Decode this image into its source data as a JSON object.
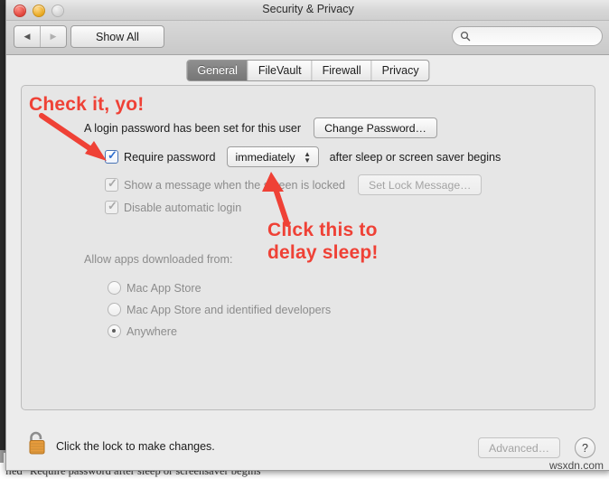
{
  "window": {
    "title": "Security & Privacy",
    "traffic_lights": [
      "close-button",
      "minimize-button",
      "zoom-button"
    ]
  },
  "toolbar": {
    "back_label": "◀",
    "forward_label": "▶",
    "show_all_label": "Show All",
    "search_placeholder": "",
    "search_value": "",
    "search_icon": "search-icon"
  },
  "tabs": [
    {
      "label": "General",
      "active": true
    },
    {
      "label": "FileVault",
      "active": false
    },
    {
      "label": "Firewall",
      "active": false
    },
    {
      "label": "Privacy",
      "active": false
    }
  ],
  "general": {
    "password_status": "A login password has been set for this user",
    "change_password_label": "Change Password…",
    "require_password": {
      "label": "Require password",
      "checked": true,
      "delay_value": "immediately",
      "suffix": "after sleep or screen saver begins"
    },
    "show_message": {
      "label": "Show a message when the screen is locked",
      "checked": true,
      "enabled": false,
      "button_label": "Set Lock Message…"
    },
    "disable_auto_login": {
      "label": "Disable automatic login",
      "checked": true,
      "enabled": false
    },
    "allow_apps_label": "Allow apps downloaded from:",
    "allow_apps_options": [
      {
        "label": "Mac App Store",
        "selected": false
      },
      {
        "label": "Mac App Store and identified developers",
        "selected": false
      },
      {
        "label": "Anywhere",
        "selected": true
      }
    ]
  },
  "footer": {
    "lock_icon": "open-padlock-icon",
    "lock_message": "Click the lock to make changes.",
    "advanced_label": "Advanced…",
    "advanced_enabled": false,
    "help_label": "?"
  },
  "annotations": [
    {
      "text": "Check it, yo!",
      "color": "#ef4136"
    },
    {
      "line1": "Click this to",
      "line2": "delay sleep!",
      "color": "#ef4136"
    }
  ],
  "background_page": {
    "text": "lled \"Require password after sleep or screensaver begins"
  },
  "watermark": "wsxdn.com"
}
